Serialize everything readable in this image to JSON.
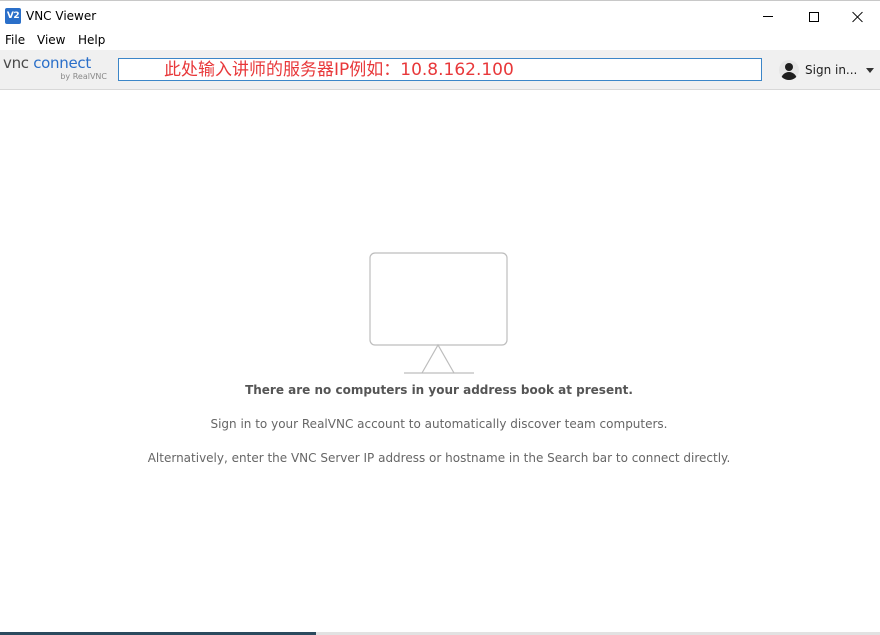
{
  "window": {
    "app_icon_text": "V2",
    "title": "VNC Viewer",
    "buttons": [
      "minimize-icon",
      "maximize-icon",
      "close-icon"
    ]
  },
  "menu": {
    "items": [
      {
        "label": "File"
      },
      {
        "label": "View"
      },
      {
        "label": "Help"
      }
    ]
  },
  "toolbar": {
    "logo_main_prefix": "vnc",
    "logo_main_suffix": " connect",
    "logo_sub": "by RealVNC",
    "search": {
      "value": "",
      "placeholder": "此处输入讲师的服务器IP例如：10.8.162.100"
    },
    "signin": {
      "avatar_icon": "user-icon",
      "label": "Sign in...",
      "dropdown_icon": "chevron-down-icon"
    }
  },
  "empty_state": {
    "icon": "monitor-icon",
    "heading": "There are no computers in your address book at present.",
    "line1": "Sign in to your RealVNC account to automatically discover team computers.",
    "line2": "Alternatively, enter the VNC Server IP address or hostname in the Search bar to connect directly."
  },
  "colors": {
    "accent": "#2a6fc9",
    "search_border": "#3c86c8",
    "search_text": "#e8383a",
    "status_bar": "#2b4a5e"
  }
}
